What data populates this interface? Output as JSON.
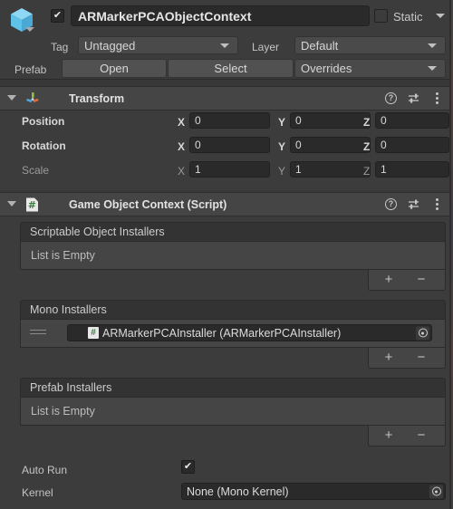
{
  "colors": {
    "panel_bg": "#383838",
    "header_bg": "#3c3c3c",
    "component_header_bg": "#454545",
    "field_bg": "#2a2a2a",
    "dropdown_bg": "#4a4a4a",
    "accent_cube": "#6fc9ef",
    "script_green": "#3f7a43"
  },
  "header": {
    "gameobject_icon": "cube-icon",
    "icon_dropdown": "chevron-down-icon",
    "enabled_checkbox": {
      "name": "gameobject-enabled-checkbox",
      "checked": true
    },
    "name_value": "ARMarkerPCAObjectContext",
    "static_checkbox": {
      "name": "static-checkbox",
      "checked": false
    },
    "static_label": "Static",
    "static_dropdown_icon": "chevron-down-icon",
    "tag_label": "Tag",
    "tag_value": "Untagged",
    "layer_label": "Layer",
    "layer_value": "Default",
    "prefab_label": "Prefab",
    "prefab_open": "Open",
    "prefab_select": "Select",
    "prefab_overrides": "Overrides"
  },
  "components": [
    {
      "id": "transform",
      "title": "Transform",
      "icon": "transform-axis-icon",
      "foldout_icon": "triangle-down-icon",
      "help_icon": "help-icon",
      "preset_icon": "preset-sliders-icon",
      "menu_icon": "kebab-menu-icon",
      "rows": [
        {
          "label": "Position",
          "dim": false,
          "x": "0",
          "y": "0",
          "z": "0"
        },
        {
          "label": "Rotation",
          "dim": false,
          "x": "0",
          "y": "0",
          "z": "0"
        },
        {
          "label": "Scale",
          "dim": true,
          "x": "1",
          "y": "1",
          "z": "1"
        }
      ],
      "axis_labels": {
        "x": "X",
        "y": "Y",
        "z": "Z"
      }
    },
    {
      "id": "game-object-context",
      "title": "Game Object Context (Script)",
      "icon": "script-icon",
      "foldout_icon": "triangle-down-icon",
      "help_icon": "help-icon",
      "preset_icon": "preset-sliders-icon",
      "menu_icon": "kebab-menu-icon"
    }
  ],
  "script_fields": {
    "scriptable_object_installers": {
      "header": "Scriptable Object Installers",
      "empty_text": "List is Empty",
      "items": [],
      "add_label": "+",
      "remove_label": "−"
    },
    "mono_installers": {
      "header": "Mono Installers",
      "items": [
        {
          "drag_handle": "drag-handle-icon",
          "icon": "script-icon",
          "value": "ARMarkerPCAInstaller (ARMarkerPCAInstaller)",
          "picker_icon": "object-picker-icon"
        }
      ],
      "add_label": "+",
      "remove_label": "−"
    },
    "prefab_installers": {
      "header": "Prefab Installers",
      "empty_text": "List is Empty",
      "items": [],
      "add_label": "+",
      "remove_label": "−"
    },
    "auto_run": {
      "label": "Auto Run",
      "checked": true
    },
    "kernel": {
      "label": "Kernel",
      "value": "None (Mono Kernel)",
      "picker_icon": "object-picker-icon"
    }
  }
}
